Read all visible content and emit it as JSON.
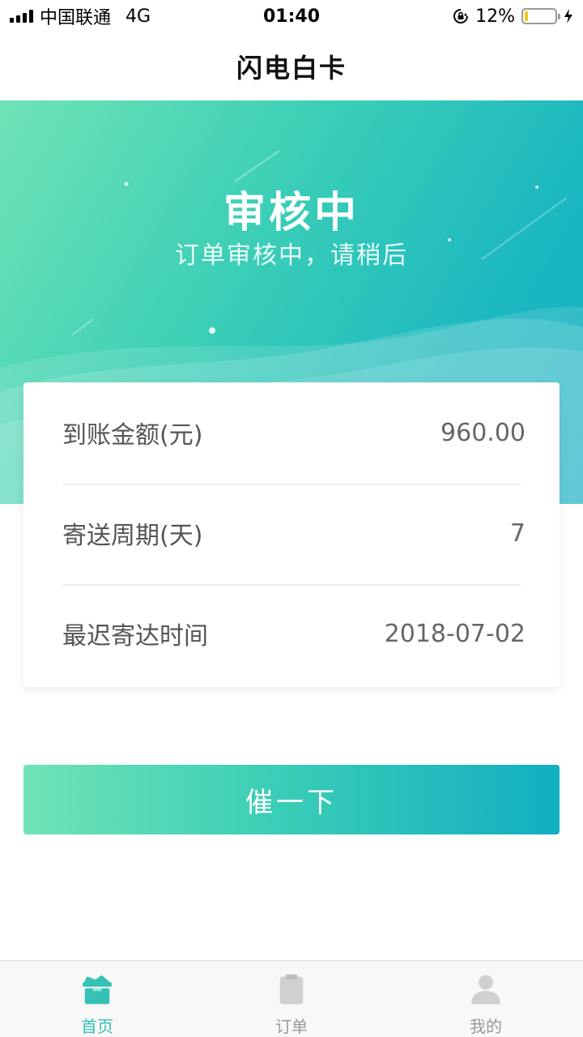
{
  "status_bar": {
    "carrier": "中国联通",
    "network": "4G",
    "time": "01:40",
    "battery": "12%",
    "battery_level": 0.12
  },
  "nav": {
    "title": "闪电白卡"
  },
  "hero": {
    "title": "审核中",
    "subtitle": "订单审核中，请稍后"
  },
  "info": {
    "rows": [
      {
        "label": "到账金额(元)",
        "value": "960.00"
      },
      {
        "label": "寄送周期(天)",
        "value": "7"
      },
      {
        "label": "最迟寄达时间",
        "value": "2018-07-02"
      }
    ]
  },
  "actions": {
    "urge_label": "催一下"
  },
  "tab_bar": {
    "tabs": [
      {
        "label": "首页",
        "icon": "home-icon",
        "active": true
      },
      {
        "label": "订单",
        "icon": "order-icon",
        "active": false
      },
      {
        "label": "我的",
        "icon": "user-icon",
        "active": false
      }
    ]
  },
  "colors": {
    "accent": "#35c2b4",
    "gradient_start": "#6fe3b6",
    "gradient_end": "#12aec2",
    "battery_fill": "#f5c518"
  }
}
